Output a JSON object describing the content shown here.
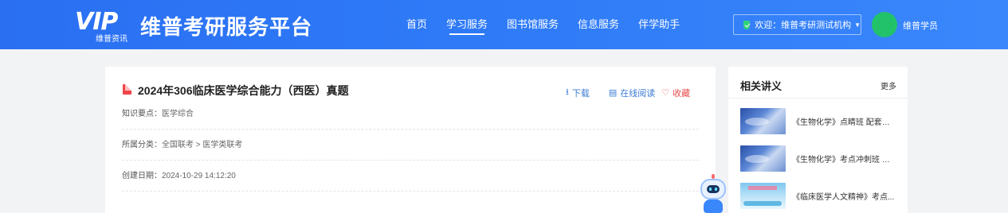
{
  "header": {
    "logo_mark": "VIP",
    "logo_sub": "维普资讯",
    "title": "维普考研服务平台",
    "nav": [
      {
        "label": "首页",
        "active": false
      },
      {
        "label": "学习服务",
        "active": true
      },
      {
        "label": "图书馆服务",
        "active": false
      },
      {
        "label": "信息服务",
        "active": false
      },
      {
        "label": "伴学助手",
        "active": false
      }
    ],
    "welcome": "欢迎：维普考研测试机构",
    "username": "维普学员"
  },
  "document": {
    "title": "2024年306临床医学综合能力（西医）真题",
    "actions": {
      "download": "下载",
      "read_online": "在线阅读",
      "favorite": "收藏"
    },
    "meta": [
      {
        "label": "知识要点：",
        "value": "医学综合"
      },
      {
        "label": "所属分类：",
        "value": "全国联考 > 医学类联考"
      },
      {
        "label": "创建日期：",
        "value": "2024-10-29 14:12:20"
      }
    ]
  },
  "side": {
    "title": "相关讲义",
    "more": "更多",
    "items": [
      {
        "text": "《生物化学》点睛班 配套讲义"
      },
      {
        "text": "《生物化学》考点冲刺班 配..."
      },
      {
        "text": "《临床医学人文精神》考点..."
      }
    ]
  },
  "colors": {
    "header_blue": "#2e7af7",
    "accent_link": "#3a7bd5",
    "favorite_red": "#e84a4a",
    "avatar_green": "#22c26b"
  }
}
